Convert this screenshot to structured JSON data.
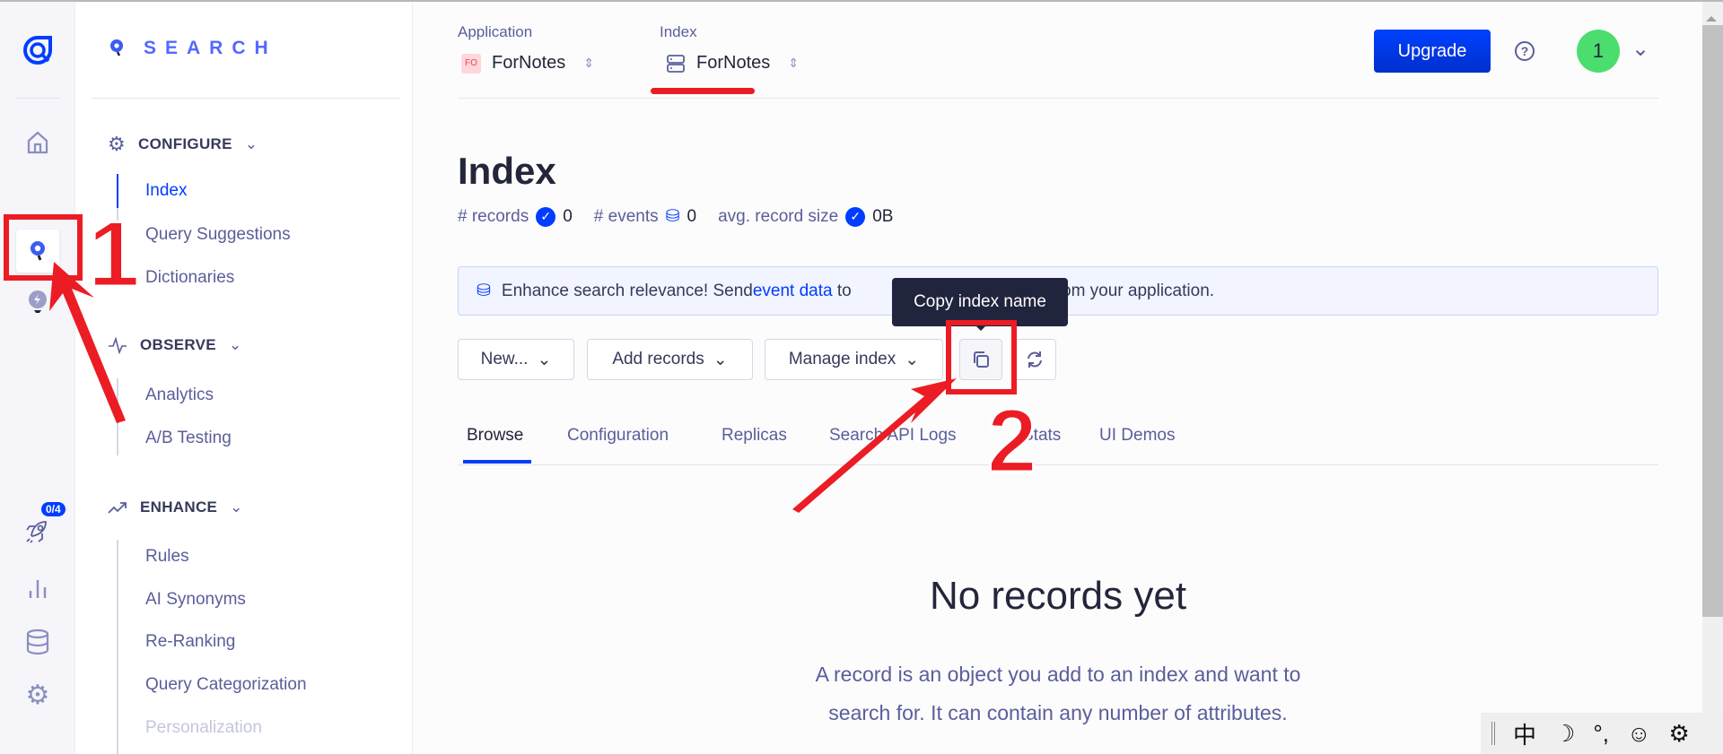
{
  "rail": {
    "items": [
      {
        "icon": "algolia-logo-icon"
      },
      {
        "icon": "home-icon"
      },
      {
        "icon": "search-icon",
        "active": true
      },
      {
        "icon": "lightbulb-icon"
      },
      {
        "icon": "rocket-icon",
        "badge": "0/4"
      },
      {
        "icon": "bar-chart-icon"
      },
      {
        "icon": "database-icon"
      },
      {
        "icon": "gear-icon"
      }
    ]
  },
  "sidebar": {
    "title": "SEARCH",
    "sections": [
      {
        "label": "CONFIGURE",
        "icon": "gear-icon",
        "items": [
          "Index",
          "Query Suggestions",
          "Dictionaries"
        ],
        "active": "Index"
      },
      {
        "label": "OBSERVE",
        "icon": "pulse-icon",
        "items": [
          "Analytics",
          "A/B Testing"
        ]
      },
      {
        "label": "ENHANCE",
        "icon": "trend-up-icon",
        "items": [
          "Rules",
          "AI Synonyms",
          "Re-Ranking",
          "Query Categorization",
          "Personalization"
        ]
      }
    ]
  },
  "header": {
    "application_label": "Application",
    "application_badge": "FO",
    "application_value": "ForNotes",
    "index_label": "Index",
    "index_value": "ForNotes",
    "upgrade": "Upgrade",
    "avatar": "1"
  },
  "page": {
    "title": "Index",
    "stats": {
      "records_label": "# records",
      "records": "0",
      "events_label": "# events",
      "events": "0",
      "size_label": "avg. record size",
      "size": "0B"
    },
    "banner": {
      "pre": "Enhance search relevance! Send ",
      "link": "event data",
      "post": " to",
      "tail": "om your application."
    },
    "buttons": {
      "new": "New...",
      "add": "Add records",
      "manage": "Manage index"
    },
    "tooltip": "Copy index name",
    "tabs": [
      "Browse",
      "Configuration",
      "Replicas",
      "Search API Logs",
      "Stats",
      "UI Demos"
    ],
    "active_tab": "Browse",
    "empty_title": "No records yet",
    "empty_line1": "A record is an object you add to an index and want to",
    "empty_line2": "search for. It can contain any number of attributes."
  },
  "annotations": {
    "one": "1",
    "two": "2",
    "color": "#ec1c24"
  },
  "ime": {
    "items": [
      "中",
      "☽",
      "°,",
      "☺",
      "⚙"
    ]
  },
  "colors": {
    "accent": "#003dff",
    "avatar": "#4bde6e"
  }
}
